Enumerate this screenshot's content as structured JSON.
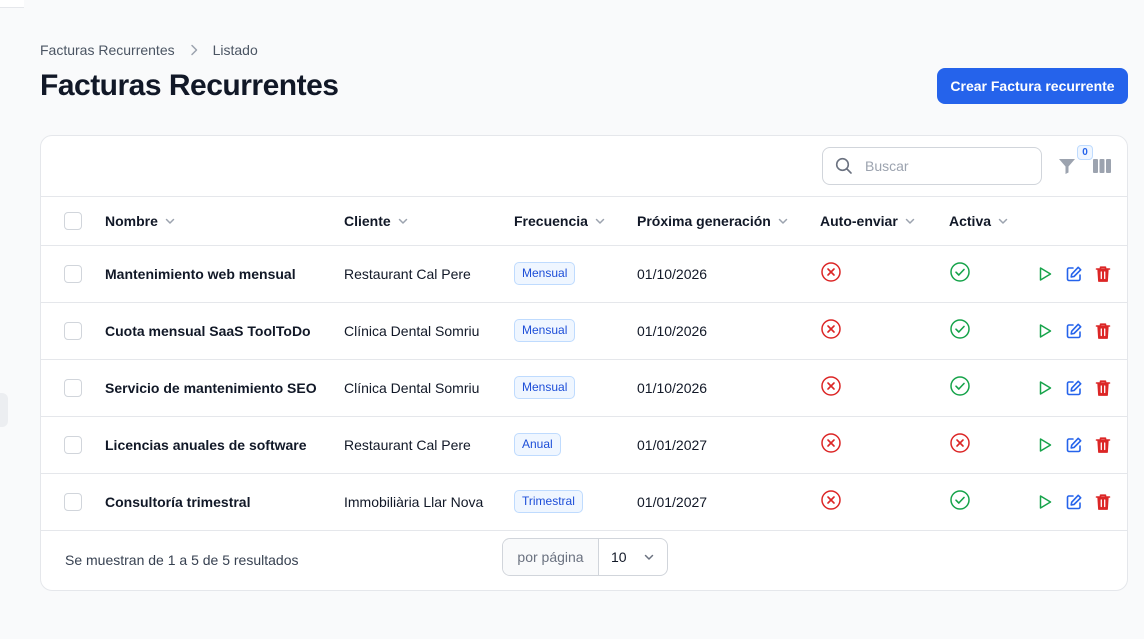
{
  "breadcrumb": {
    "parent": "Facturas Recurrentes",
    "current": "Listado"
  },
  "page": {
    "title": "Facturas Recurrentes",
    "create_label": "Crear Factura recurrente"
  },
  "toolbar": {
    "search_placeholder": "Buscar",
    "filter_count": "0"
  },
  "table": {
    "columns": [
      "Nombre",
      "Cliente",
      "Frecuencia",
      "Próxima generación",
      "Auto-enviar",
      "Activa"
    ],
    "rows": [
      {
        "name": "Mantenimiento web mensual",
        "client": "Restaurant Cal Pere",
        "frequency": "Mensual",
        "next": "01/10/2026",
        "auto_send": false,
        "active": true
      },
      {
        "name": "Cuota mensual SaaS ToolToDo",
        "client": "Clínica Dental Somriu",
        "frequency": "Mensual",
        "next": "01/10/2026",
        "auto_send": false,
        "active": true
      },
      {
        "name": "Servicio de mantenimiento SEO",
        "client": "Clínica Dental Somriu",
        "frequency": "Mensual",
        "next": "01/10/2026",
        "auto_send": false,
        "active": true
      },
      {
        "name": "Licencias anuales de software",
        "client": "Restaurant Cal Pere",
        "frequency": "Anual",
        "next": "01/01/2027",
        "auto_send": false,
        "active": false
      },
      {
        "name": "Consultoría trimestral",
        "client": "Immobiliària Llar Nova",
        "frequency": "Trimestral",
        "next": "01/01/2027",
        "auto_send": false,
        "active": true
      }
    ]
  },
  "footer": {
    "results": "Se muestran de 1 a 5 de 5 resultados",
    "per_page_label": "por página",
    "per_page_value": "10"
  },
  "colors": {
    "primary": "#2563eb",
    "success": "#16a34a",
    "danger": "#dc2626",
    "edit": "#2563eb"
  }
}
